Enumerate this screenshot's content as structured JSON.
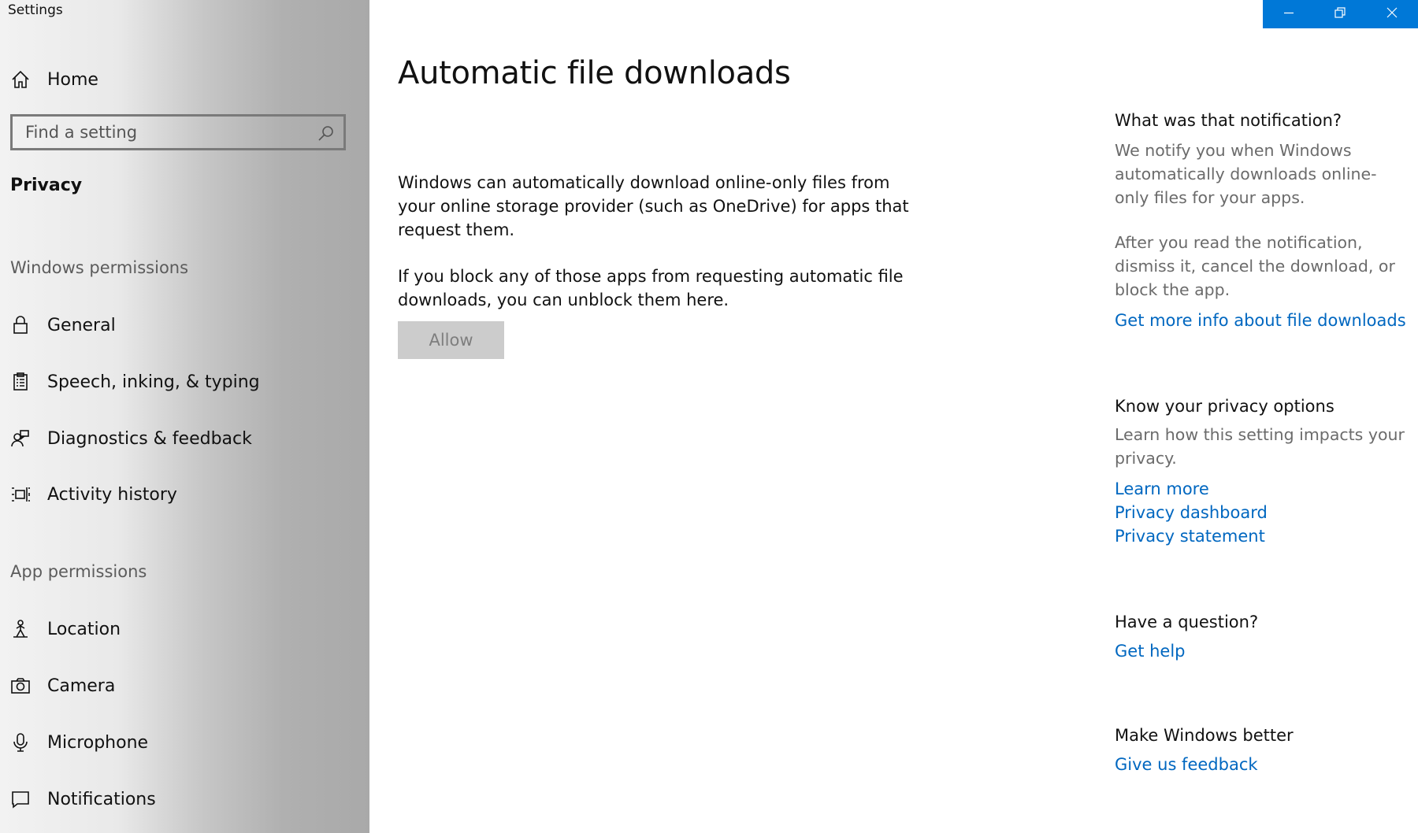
{
  "window": {
    "title": "Settings",
    "controls": [
      {
        "name": "minimize-icon"
      },
      {
        "name": "restore-icon"
      },
      {
        "name": "close-icon"
      }
    ],
    "titlebar_color": "#0078d7"
  },
  "sidebar": {
    "home_label": "Home",
    "search_placeholder": "Find a setting",
    "category": "Privacy",
    "windows_permissions_heading": "Windows permissions",
    "windows_permissions_items": [
      {
        "label": "General",
        "icon": "lock-icon"
      },
      {
        "label": "Speech, inking, & typing",
        "icon": "clipboard-icon"
      },
      {
        "label": "Diagnostics & feedback",
        "icon": "feedback-person-icon"
      },
      {
        "label": "Activity history",
        "icon": "timeline-icon"
      }
    ],
    "app_permissions_heading": "App permissions",
    "app_permissions_items": [
      {
        "label": "Location",
        "icon": "location-person-icon"
      },
      {
        "label": "Camera",
        "icon": "camera-icon"
      },
      {
        "label": "Microphone",
        "icon": "microphone-icon"
      },
      {
        "label": "Notifications",
        "icon": "notification-icon"
      }
    ]
  },
  "main": {
    "title": "Automatic file downloads",
    "description": "Windows can automatically download online-only files from your online storage provider (such as OneDrive) for apps that request them.",
    "block_note": "If you block any of those apps from requesting automatic file downloads, you can unblock them here.",
    "allow_button": "Allow",
    "allow_enabled": false
  },
  "aside": {
    "notification_heading": "What was that notification?",
    "notification_text_1": "We notify you when Windows automatically downloads online-only files for your apps.",
    "notification_text_2": "After you read the notification, dismiss it, cancel the download, or block the app.",
    "notification_link": "Get more info about file downloads",
    "privacy_heading": "Know your privacy options",
    "privacy_text": "Learn how this setting impacts your privacy.",
    "privacy_links": [
      "Learn more",
      "Privacy dashboard",
      "Privacy statement"
    ],
    "question_heading": "Have a question?",
    "question_link": "Get help",
    "better_heading": "Make Windows better",
    "better_link": "Give us feedback"
  },
  "colors": {
    "link": "#0067c0",
    "accent": "#0078d7",
    "disabled_button_bg": "#cccccc",
    "disabled_button_text": "#7e7e7e"
  }
}
